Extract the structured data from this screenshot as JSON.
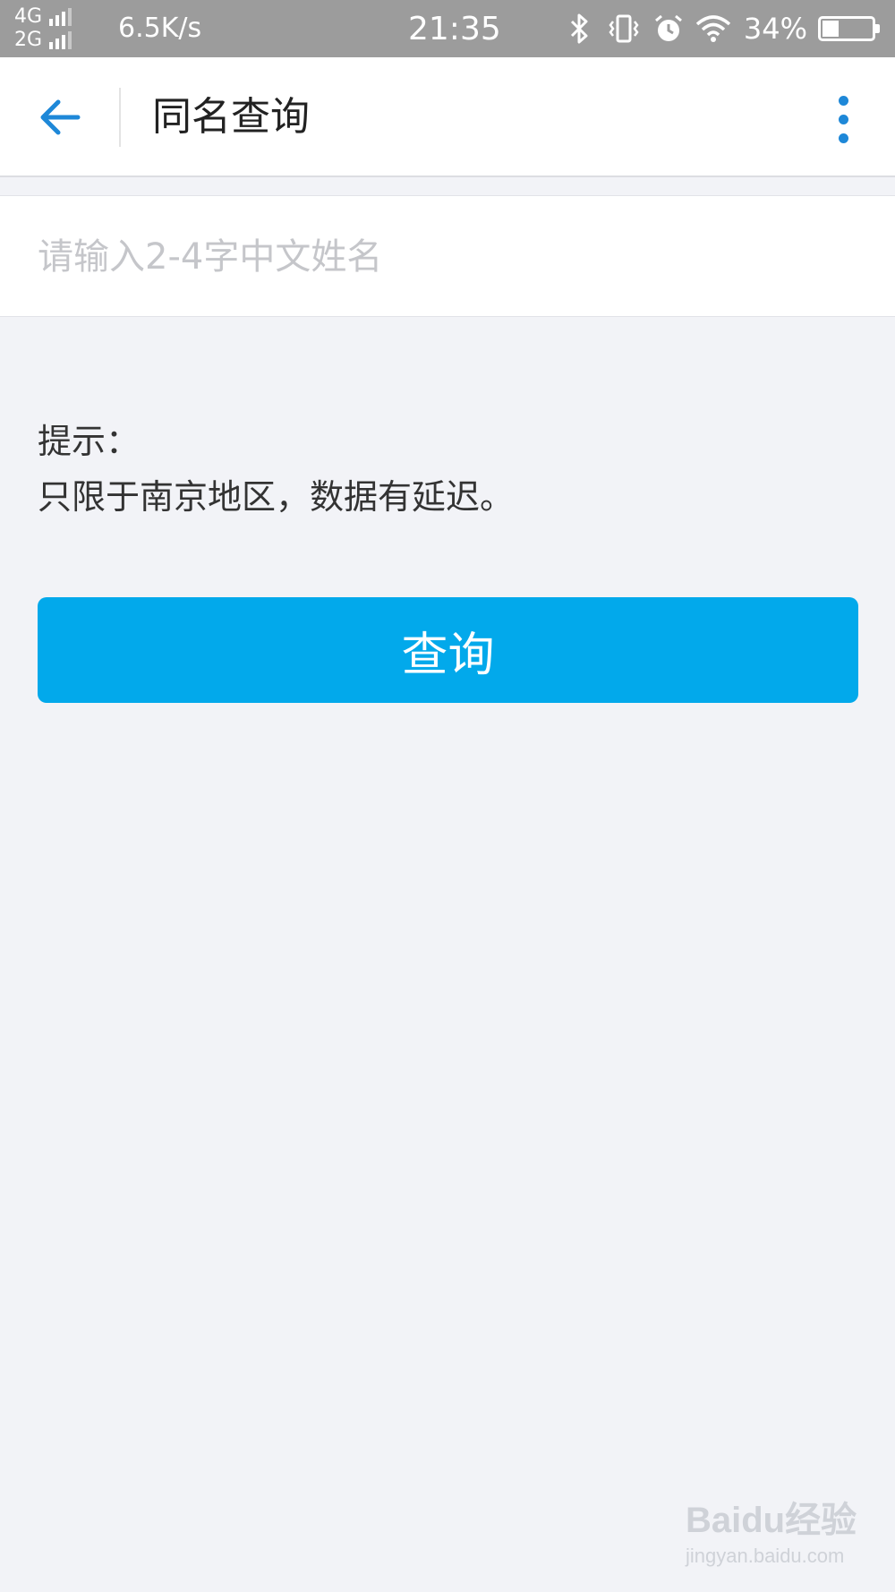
{
  "status_bar": {
    "network_1": "4G",
    "network_2": "2G",
    "speed": "6.5K/s",
    "time": "21:35",
    "battery_percent": "34%",
    "battery_level": 0.34,
    "icons": [
      "bluetooth-icon",
      "vibrate-icon",
      "alarm-icon",
      "wifi-icon",
      "battery-icon"
    ]
  },
  "header": {
    "title": "同名查询",
    "back_icon": "arrow-left-icon",
    "more_icon": "more-vertical-icon",
    "accent_color": "#1e88d8"
  },
  "search": {
    "placeholder": "请输入2-4字中文姓名",
    "value": ""
  },
  "tip": {
    "label": "提示：",
    "text": "只限于南京地区，数据有延迟。"
  },
  "actions": {
    "query_label": "查询",
    "button_color": "#02a9eb"
  },
  "watermark": {
    "brand": "Baidu经验",
    "url": "jingyan.baidu.com"
  }
}
